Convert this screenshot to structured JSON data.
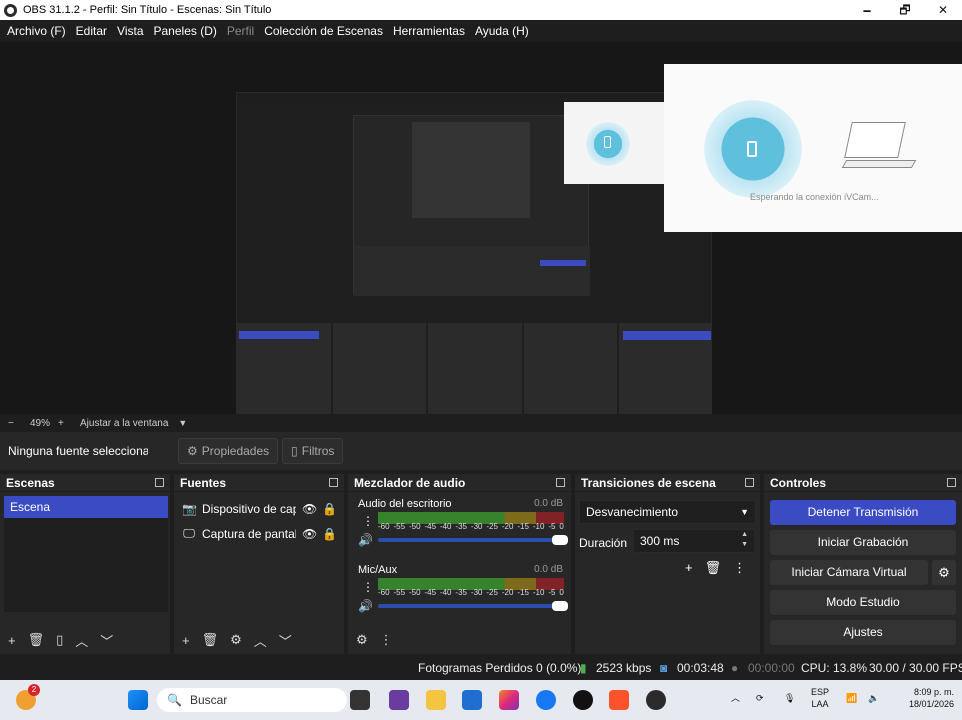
{
  "window": {
    "title": "OBS 31.1.2 - Perfil: Sin Título - Escenas: Sin Título",
    "controls": [
      "🗕",
      "🗗",
      "✕"
    ]
  },
  "menu": [
    "Archivo (F)",
    "Editar",
    "Vista",
    "Paneles (D)",
    "Perfil",
    "Colección de Escenas",
    "Herramientas",
    "Ayuda (H)"
  ],
  "preview_overlay": {
    "waiting_text": "Esperando la conexión iVCam..."
  },
  "preview_bar": {
    "minus": "−",
    "zoom": "49%",
    "plus": "+",
    "fit": "Ajustar a la ventana",
    "caret": "▼"
  },
  "context": {
    "no_source": "Ninguna fuente seleccionada",
    "properties": "Propiedades",
    "filters": "Filtros"
  },
  "scenes": {
    "title": "Escenas",
    "items": [
      "Escena"
    ]
  },
  "sources": {
    "title": "Fuentes",
    "items": [
      {
        "name": "Dispositivo de captura de vídeo"
      },
      {
        "name": "Captura de pantalla"
      }
    ]
  },
  "mixer": {
    "title": "Mezclador de audio",
    "channels": [
      {
        "name": "Audio del escritorio",
        "db": "0.0 dB"
      },
      {
        "name": "Mic/Aux",
        "db": "0.0 dB"
      }
    ],
    "ticks": [
      "-60",
      "-55",
      "-50",
      "-45",
      "-40",
      "-35",
      "-30",
      "-25",
      "-20",
      "-15",
      "-10",
      "-5",
      "0"
    ]
  },
  "transitions": {
    "title": "Transiciones de escena",
    "selected": "Desvanecimiento",
    "duration_label": "Duración",
    "duration_value": "300 ms"
  },
  "controls": {
    "title": "Controles",
    "stop_stream": "Detener Transmisión",
    "start_recording": "Iniciar Grabación",
    "start_virtual_cam": "Iniciar Cámara Virtual",
    "studio_mode": "Modo Estudio",
    "settings": "Ajustes"
  },
  "status": {
    "dropped_frames": "Fotogramas Perdidos 0 (0.0%)",
    "bitrate": "2523 kbps",
    "stream_time": "00:03:48",
    "rec_time": "00:00:00",
    "cpu": "CPU: 13.8%",
    "fps": "30.00 / 30.00 FPS"
  },
  "taskbar": {
    "search_placeholder": "Buscar",
    "badge_count": "2",
    "lang_top": "ESP",
    "lang_bottom": "LAA",
    "time": "8:09 p. m.",
    "date": "18/01/2026"
  },
  "colors": {
    "accent_blue": "#3a4bc4",
    "panel_bg": "#272727",
    "window_bg": "#1e1e1e"
  }
}
